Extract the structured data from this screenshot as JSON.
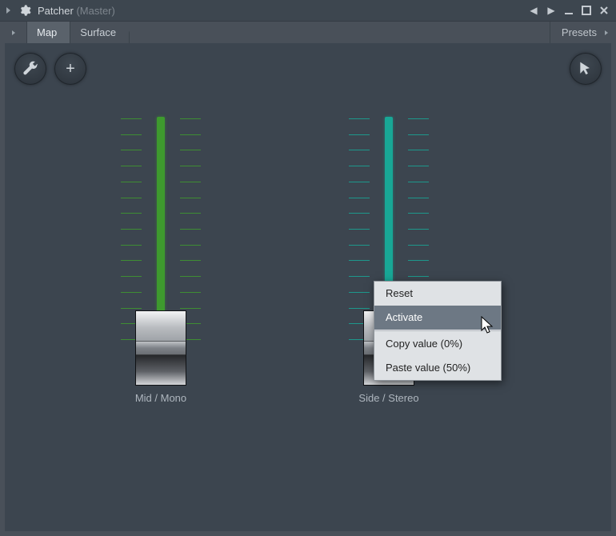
{
  "titlebar": {
    "app_name": "Patcher",
    "context": "(Master)"
  },
  "tabs": {
    "map": "Map",
    "surface": "Surface",
    "presets_label": "Presets"
  },
  "toolbar": {
    "wrench_icon": "wrench-icon",
    "plus_label": "+",
    "mouse_icon": "mouse-pointer-icon"
  },
  "sliders": {
    "mid": {
      "label": "Mid / Mono"
    },
    "side": {
      "label": "Side / Stereo"
    }
  },
  "context_menu": {
    "reset": "Reset",
    "activate": "Activate",
    "copy": "Copy value (0%)",
    "paste": "Paste value (50%)"
  }
}
